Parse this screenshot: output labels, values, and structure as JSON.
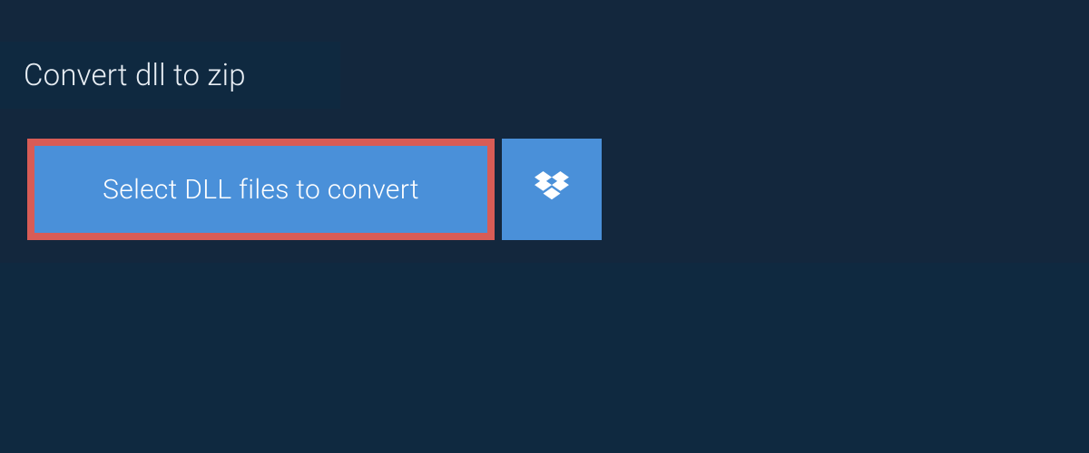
{
  "tab": {
    "title": "Convert dll to zip"
  },
  "actions": {
    "select_files_label": "Select DLL files to convert"
  },
  "colors": {
    "background_dark": "#0f2940",
    "band_dark": "#13273d",
    "button_blue": "#4a90d9",
    "highlight_red": "#d85c56"
  }
}
